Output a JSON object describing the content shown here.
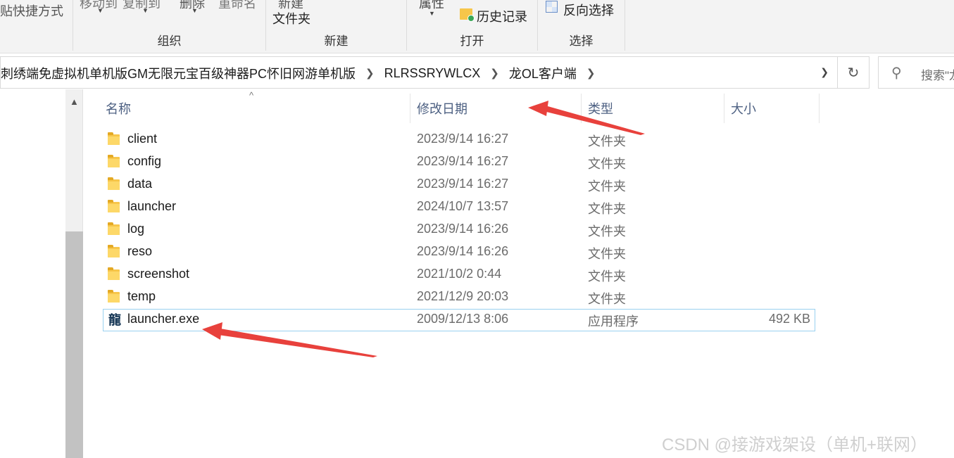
{
  "ribbon": {
    "clipboard_paste_shortcut": "贴快捷方式",
    "organize": {
      "move_to": "移动到",
      "copy_to": "复制到",
      "delete": "删除",
      "rename": "重命名",
      "label": "组织"
    },
    "new": {
      "new_folder_line1": "新建",
      "new_folder_line2": "文件夹",
      "label": "新建"
    },
    "open": {
      "properties": "属性",
      "history": "历史记录",
      "label": "打开"
    },
    "select": {
      "invert": "反向选择",
      "label": "选择"
    }
  },
  "address": {
    "crumbs": [
      "刺绣端免虚拟机单机版GM无限元宝百级神器PC怀旧网游单机版",
      "RLRSSRYWLCX",
      "龙OL客户端"
    ]
  },
  "search": {
    "placeholder": "搜索\"龙"
  },
  "columns": {
    "name": "名称",
    "date": "修改日期",
    "type": "类型",
    "size": "大小"
  },
  "files": [
    {
      "name": "client",
      "date": "2023/9/14 16:27",
      "type": "文件夹",
      "size": "",
      "icon": "folder-icon"
    },
    {
      "name": "config",
      "date": "2023/9/14 16:27",
      "type": "文件夹",
      "size": "",
      "icon": "folder-icon"
    },
    {
      "name": "data",
      "date": "2023/9/14 16:27",
      "type": "文件夹",
      "size": "",
      "icon": "folder-icon"
    },
    {
      "name": "launcher",
      "date": "2024/10/7 13:57",
      "type": "文件夹",
      "size": "",
      "icon": "folder-icon"
    },
    {
      "name": "log",
      "date": "2023/9/14 16:26",
      "type": "文件夹",
      "size": "",
      "icon": "folder-icon"
    },
    {
      "name": "reso",
      "date": "2023/9/14 16:26",
      "type": "文件夹",
      "size": "",
      "icon": "folder-icon"
    },
    {
      "name": "screenshot",
      "date": "2021/10/2 0:44",
      "type": "文件夹",
      "size": "",
      "icon": "folder-icon"
    },
    {
      "name": "temp",
      "date": "2021/12/9 20:03",
      "type": "文件夹",
      "size": "",
      "icon": "folder-icon"
    },
    {
      "name": "launcher.exe",
      "date": "2009/12/13 8:06",
      "type": "应用程序",
      "size": "492 KB",
      "icon": "app-icon",
      "exe_glyph": "龍"
    }
  ],
  "watermark": "CSDN @接游戏架设（单机+联网）",
  "colors": {
    "accent_arrow": "#e8413c",
    "selection_border": "#99d1f0",
    "header_text": "#4d6082"
  }
}
